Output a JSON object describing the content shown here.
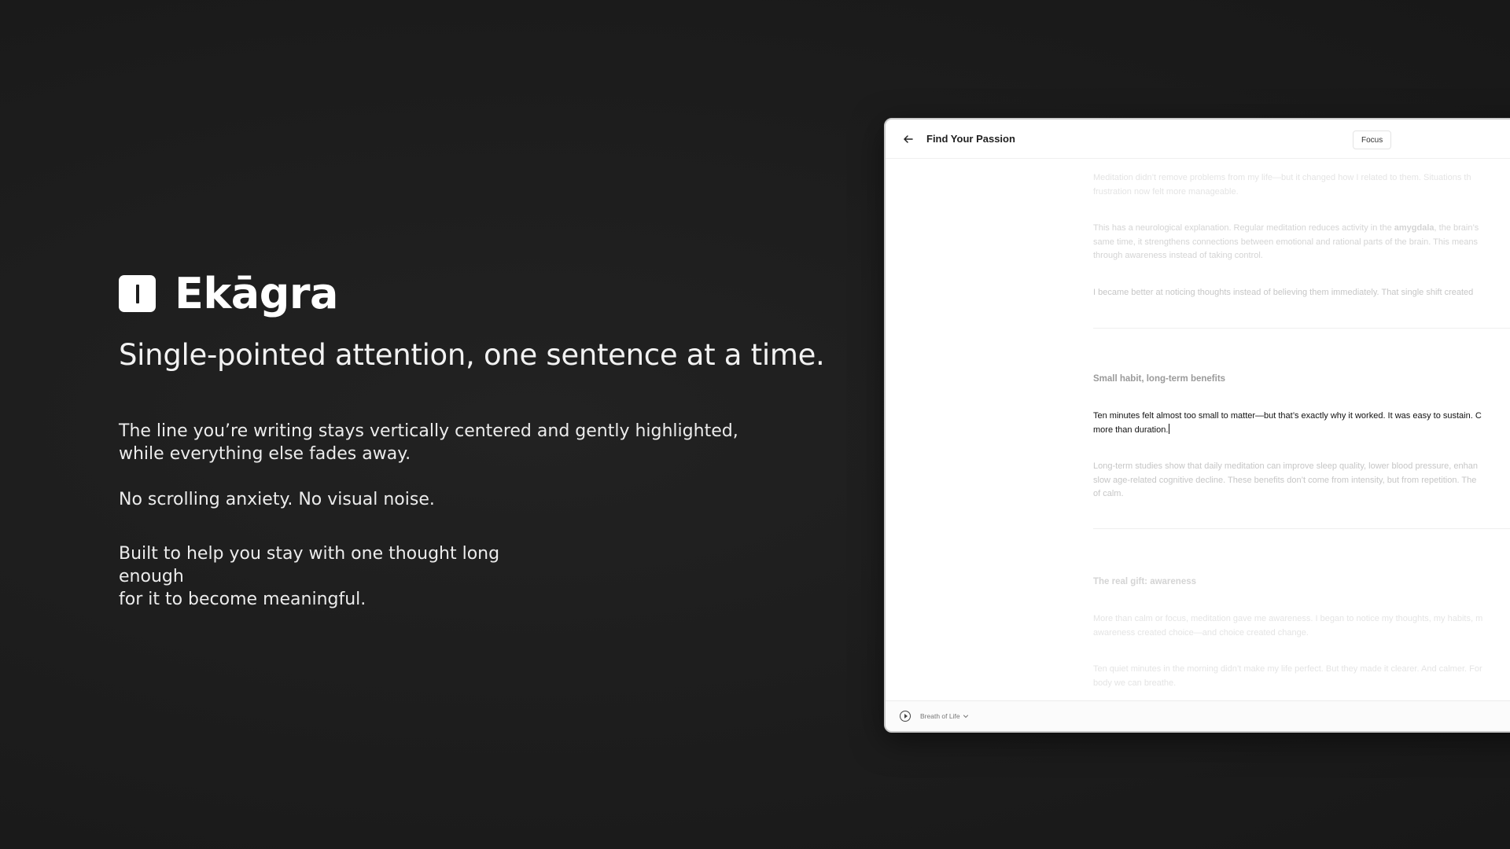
{
  "brand": {
    "name": "Ekāgra"
  },
  "hero": {
    "tagline": "Single-pointed attention, one sentence at a time.",
    "paragraph_1": "The line you’re writing stays vertically centered and gently highlighted, while everything else fades away.",
    "paragraph_2": "No scrolling anxiety. No visual noise.",
    "paragraph_3_line_1": "Built to help you stay with one thought long enough",
    "paragraph_3_line_2": "for it to become meaningful."
  },
  "app": {
    "doc_title": "Find Your Passion",
    "focus_label": "Focus",
    "document": {
      "p1_line1": "Meditation didn’t remove problems from my life—but it changed how I related to them. Situations th",
      "p1_line2": "frustration now felt more manageable.",
      "p2_line1_pre": "This has a neurological explanation. Regular meditation reduces activity in the ",
      "p2_line1_bold": "amygdala",
      "p2_line1_post": ", the brain’s",
      "p2_line2": "same time, it strengthens connections between emotional and rational parts of the brain. This means",
      "p2_line3": "through awareness instead of taking control.",
      "p3_line1": "I became better at noticing thoughts instead of believing them immediately. That single shift created",
      "heading_1": "Small habit, long-term benefits",
      "active_line1": "Ten minutes felt almost too small to matter—but that’s exactly why it worked. It was easy to sustain. C",
      "active_line2": "more than duration.",
      "p4_line1": "Long-term studies show that daily meditation can improve sleep quality, lower blood pressure, enhan",
      "p4_line2": "slow age-related cognitive decline. These benefits don’t come from intensity, but from repetition. The",
      "p4_line3": "of calm.",
      "heading_2": "The real gift: awareness",
      "p5_line1": "More than calm or focus, meditation gave me awareness. I began to notice my thoughts, my habits, m",
      "p5_line2": "awareness created choice—and choice created change.",
      "p6_line1": "Ten quiet minutes in the morning didn’t make my life perfect. But they made it clearer. And calmer. For",
      "p6_line2": "body we can breathe."
    },
    "player": {
      "track_name": "Breath of Life"
    }
  }
}
